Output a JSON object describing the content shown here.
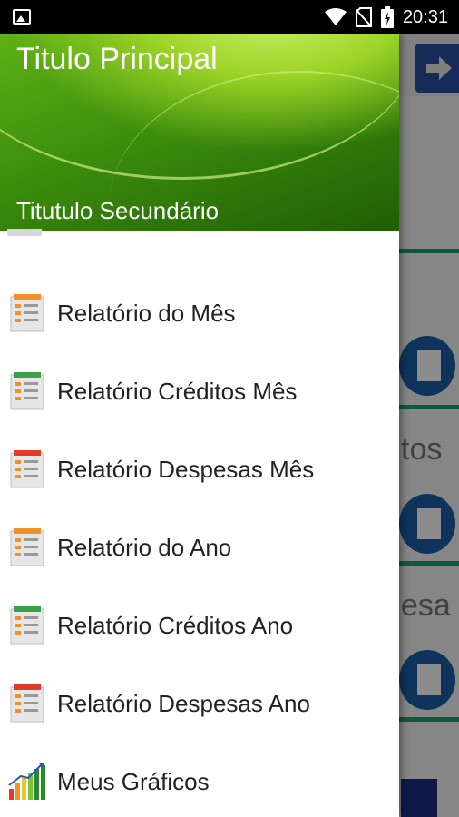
{
  "status_bar": {
    "time": "20:31",
    "icons": [
      "image-notification-icon",
      "wifi-icon",
      "no-sim-icon",
      "battery-charging-icon"
    ]
  },
  "drawer": {
    "header": {
      "title": "Titulo Principal",
      "subtitle": "Titutulo Secundário"
    },
    "items": [
      {
        "label": "Relatório do Mês",
        "icon": "report-orange-icon",
        "accent": "#f0912a"
      },
      {
        "label": "Relatório Créditos Mês",
        "icon": "report-green-icon",
        "accent": "#3aa04a"
      },
      {
        "label": "Relatório Despesas Mês",
        "icon": "report-red-icon",
        "accent": "#e23a2a"
      },
      {
        "label": "Relatório do Ano",
        "icon": "report-orange-icon",
        "accent": "#f0912a"
      },
      {
        "label": "Relatório Créditos Ano",
        "icon": "report-green-icon",
        "accent": "#3aa04a"
      },
      {
        "label": "Relatório Despesas Ano",
        "icon": "report-red-icon",
        "accent": "#e23a2a"
      },
      {
        "label": "Meus Gráficos",
        "icon": "bar-chart-icon",
        "accent": "#2a8a2a"
      }
    ]
  },
  "background": {
    "partial_texts": [
      "tos",
      "esa"
    ],
    "accent": "#1aa06f",
    "button_color": "#2b4fa3"
  }
}
